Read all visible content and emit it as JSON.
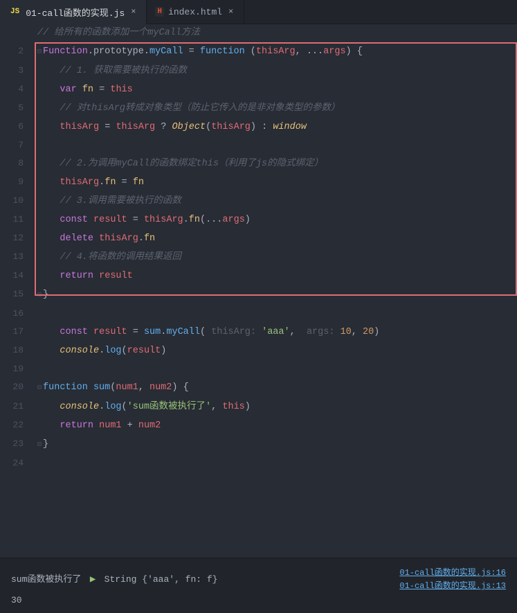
{
  "tabs": [
    {
      "id": "js-tab",
      "icon_type": "js",
      "label": "01-call函数的实现.js",
      "active": true
    },
    {
      "id": "html-tab",
      "icon_type": "html",
      "label": "index.html",
      "active": false
    }
  ],
  "code": {
    "comment_top": "// 给所有的函数添加一个myCall方法",
    "lines": [
      {
        "num": "",
        "content": ""
      },
      {
        "num": "2",
        "content": "Function.prototype.myCall = function (thisArg, ...args) {",
        "highlighted": true
      },
      {
        "num": "3",
        "content": "    // 1. 获取需要被执行的函数",
        "highlighted": true
      },
      {
        "num": "4",
        "content": "    var fn = this",
        "highlighted": true
      },
      {
        "num": "5",
        "content": "    // 对thisArg转成对象类型（防止它传入的是非对象类型的参数）",
        "highlighted": true
      },
      {
        "num": "6",
        "content": "    thisArg = thisArg ? Object(thisArg) : window",
        "highlighted": true
      },
      {
        "num": "7",
        "content": "",
        "highlighted": true
      },
      {
        "num": "8",
        "content": "    // 2.为调用myCall的函数绑定this（利用了js的隐式绑定）",
        "highlighted": true
      },
      {
        "num": "9",
        "content": "    thisArg.fn = fn",
        "highlighted": true
      },
      {
        "num": "10",
        "content": "    // 3.调用需要被执行的函数",
        "highlighted": true
      },
      {
        "num": "11",
        "content": "    const result = thisArg.fn(...args)",
        "highlighted": true
      },
      {
        "num": "12",
        "content": "    delete thisArg.fn",
        "highlighted": true
      },
      {
        "num": "13",
        "content": "    // 4.将函数的调用结果返回",
        "highlighted": true
      },
      {
        "num": "14",
        "content": "    return result",
        "highlighted": true
      },
      {
        "num": "15",
        "content": "}",
        "highlighted": true
      },
      {
        "num": "16",
        "content": ""
      },
      {
        "num": "17",
        "content": "const result = sum.myCall( thisArg: 'aaa',  args: 10, 20)"
      },
      {
        "num": "18",
        "content": "console.log(result)"
      },
      {
        "num": "19",
        "content": ""
      },
      {
        "num": "20",
        "content": "function sum(num1, num2) {"
      },
      {
        "num": "21",
        "content": "    console.log('sum函数被执行了', this)"
      },
      {
        "num": "22",
        "content": "    return num1 + num2"
      },
      {
        "num": "23",
        "content": "}"
      },
      {
        "num": "24",
        "content": ""
      }
    ]
  },
  "console": {
    "line1_prefix": "sum函数被执行了",
    "line1_arrow": "▶",
    "line1_obj": "String {'aaa', fn: f}",
    "line1_link1": "01-call函数的实现.js:16",
    "line1_link2": "01-call函数的实现.js:13",
    "line2_value": "30"
  }
}
